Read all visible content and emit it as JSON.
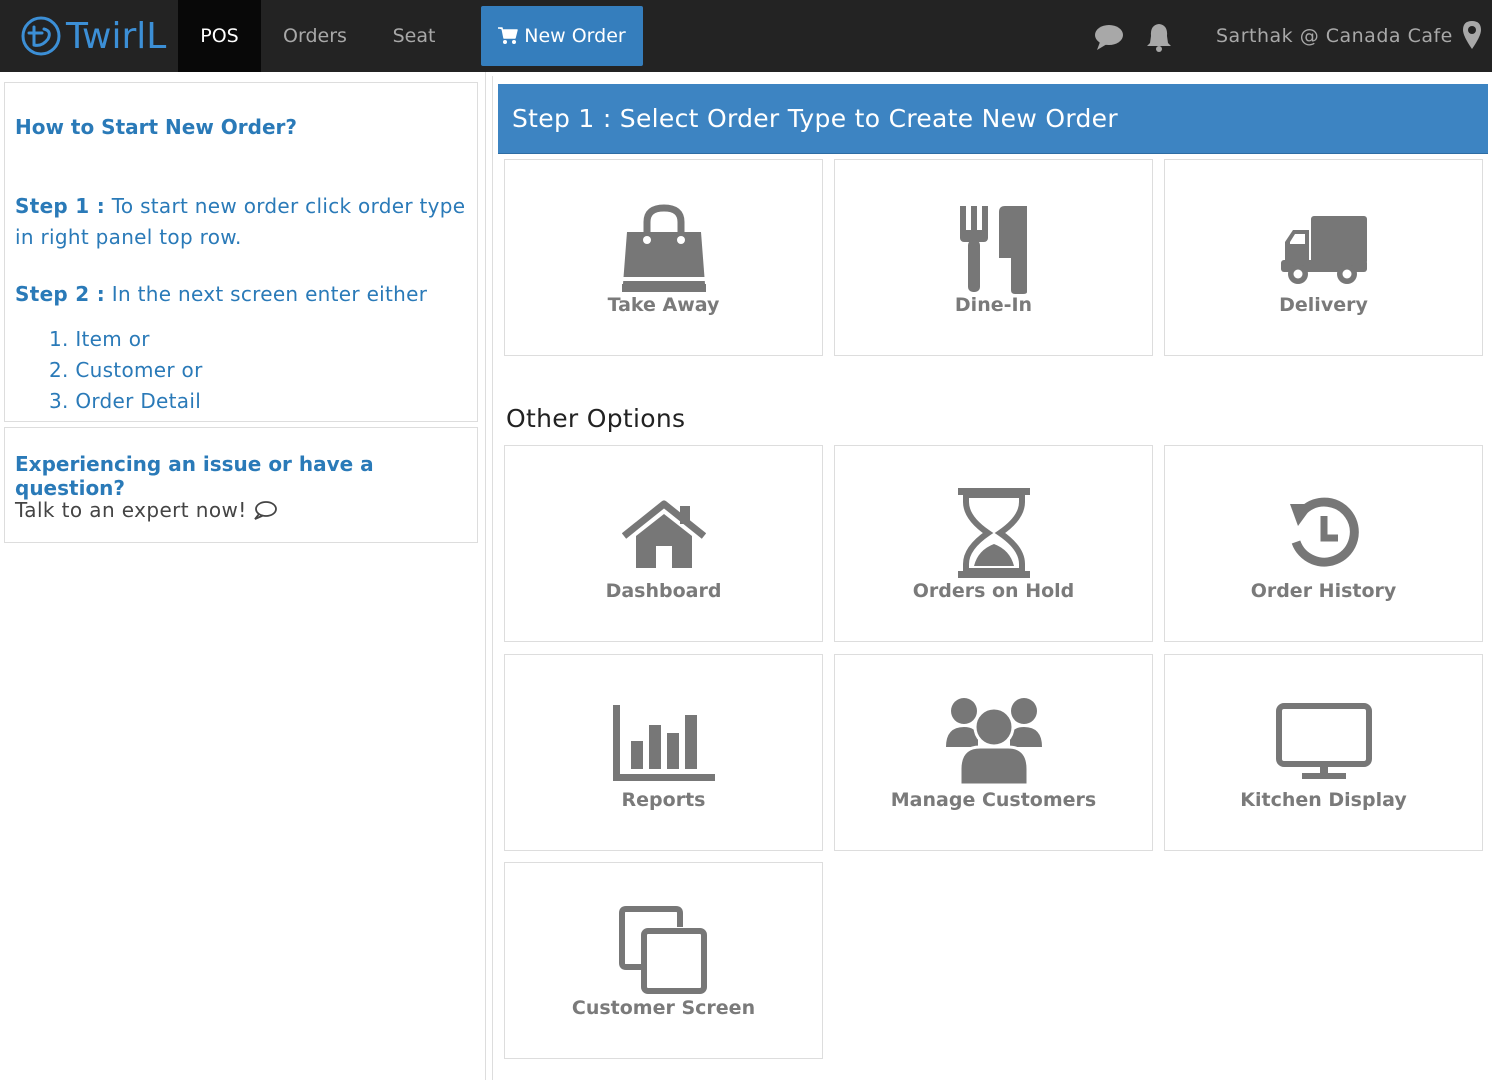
{
  "navbar": {
    "brand": "TwirlL",
    "links": [
      {
        "label": "POS",
        "active": true
      },
      {
        "label": "Orders",
        "active": false
      },
      {
        "label": "Seat",
        "active": false
      }
    ],
    "new_order_label": "New Order",
    "user_label": "Sarthak @ Canada Cafe",
    "icons": [
      "chat-icon",
      "bell-icon",
      "map-pin-icon"
    ]
  },
  "help": {
    "title": "How to Start New Order?",
    "step1_prefix": "Step 1 :",
    "step1_text": " To start new order click order type in right panel top row.",
    "step2_prefix": "Step 2 :",
    "step2_text": " In the next screen enter either",
    "list": [
      "1. Item or",
      "2. Customer or",
      "3. Order Detail"
    ]
  },
  "support": {
    "title": "Experiencing an issue or have a question?",
    "text": "Talk to an expert now!"
  },
  "main": {
    "header": "Step 1 : Select Order Type to Create New Order",
    "order_types": [
      {
        "label": "Take Away",
        "icon": "shopping-bag-icon"
      },
      {
        "label": "Dine-In",
        "icon": "fork-knife-icon"
      },
      {
        "label": "Delivery",
        "icon": "truck-icon"
      }
    ],
    "other_label": "Other Options",
    "options": [
      {
        "label": "Dashboard",
        "icon": "home-icon"
      },
      {
        "label": "Orders on Hold",
        "icon": "hourglass-icon"
      },
      {
        "label": "Order History",
        "icon": "history-icon"
      },
      {
        "label": "Reports",
        "icon": "bar-chart-icon"
      },
      {
        "label": "Manage Customers",
        "icon": "users-icon"
      },
      {
        "label": "Kitchen Display",
        "icon": "monitor-icon"
      },
      {
        "label": "Customer Screen",
        "icon": "copy-icon"
      }
    ]
  },
  "colors": {
    "navbar_bg": "#232323",
    "accent": "#3d84c2",
    "link_text": "#2a7ab8",
    "tile_icon": "#777777"
  }
}
